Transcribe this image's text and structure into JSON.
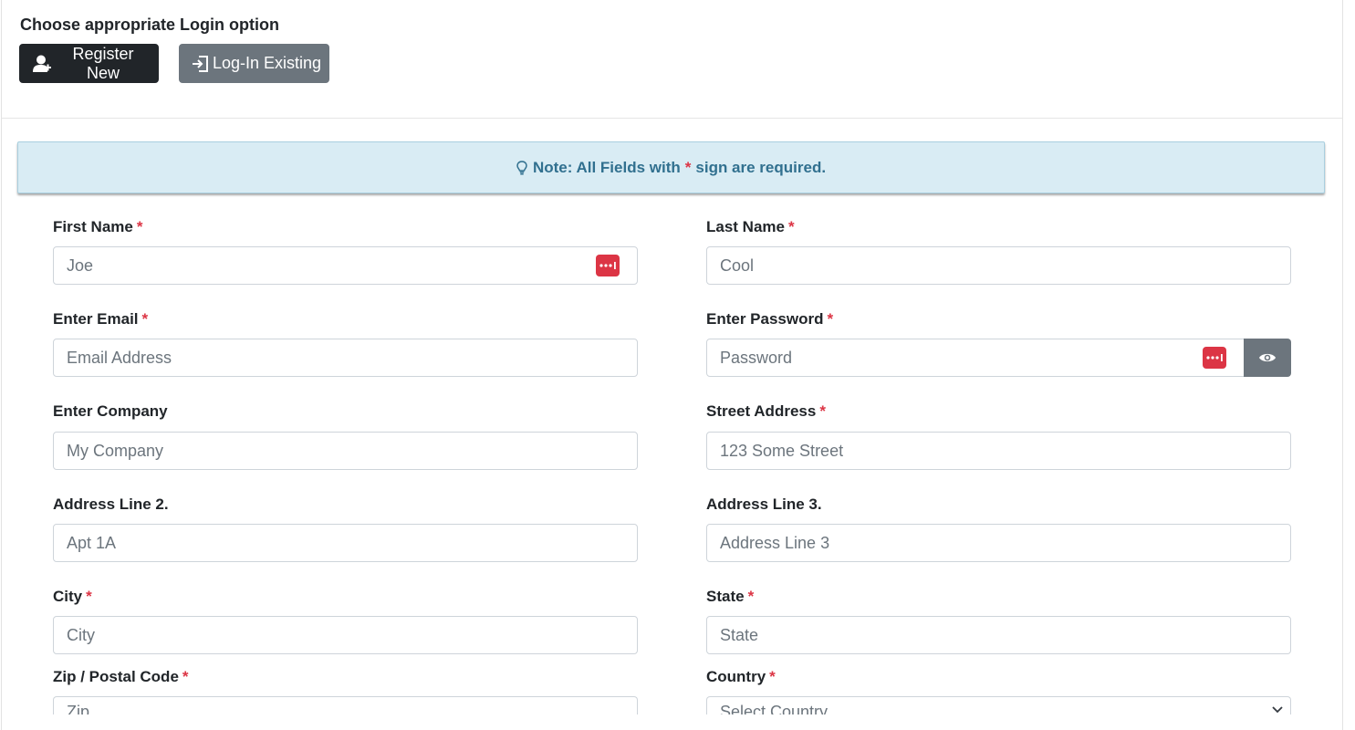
{
  "header": {
    "title": "Choose appropriate Login option",
    "register_label": "Register New",
    "login_label": "Log-In Existing"
  },
  "note": {
    "prefix": "Note: All Fields with",
    "star": "*",
    "suffix": "sign are required."
  },
  "form": {
    "required_mark": "*",
    "first_name": {
      "label": "First Name",
      "value": "Joe"
    },
    "last_name": {
      "label": "Last Name",
      "value": "Cool"
    },
    "email": {
      "label": "Enter Email",
      "placeholder": "Email Address"
    },
    "password": {
      "label": "Enter Password",
      "placeholder": "Password"
    },
    "company": {
      "label": "Enter Company",
      "placeholder": "My Company"
    },
    "street": {
      "label": "Street Address",
      "placeholder": "123 Some Street"
    },
    "address2": {
      "label": "Address Line 2.",
      "placeholder": "Apt 1A"
    },
    "address3": {
      "label": "Address Line 3.",
      "placeholder": "Address Line 3"
    },
    "city": {
      "label": "City",
      "placeholder": "City"
    },
    "state": {
      "label": "State",
      "placeholder": "State"
    },
    "zip": {
      "label": "Zip / Postal Code",
      "placeholder": "Zip"
    },
    "country": {
      "label": "Country",
      "selected": "Select Country"
    }
  },
  "colors": {
    "required": "#dc3545",
    "note_bg": "#d9ecf4",
    "note_text": "#31708f",
    "btn_dark": "#212529",
    "btn_gray": "#6c757d"
  },
  "icons": {
    "register": "user-plus-icon",
    "login": "sign-in-icon",
    "note": "lightbulb-icon",
    "password_manager": "password-manager-icon",
    "toggle_password": "eye-icon"
  }
}
